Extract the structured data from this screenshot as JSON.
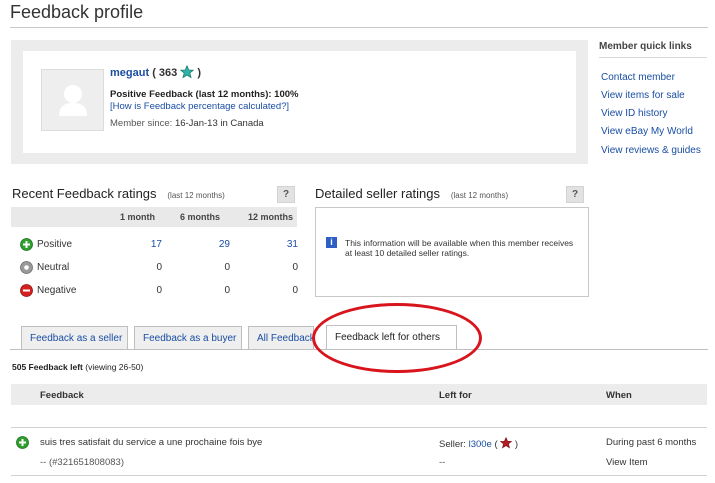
{
  "page": {
    "title": "Feedback profile"
  },
  "profile": {
    "username": "megaut",
    "score": "363",
    "positive_feedback": "Positive Feedback (last 12 months): 100%",
    "how_calc_link": "[How is Feedback percentage calculated?]",
    "member_since_label": "Member since:",
    "member_since_value": "16-Jan-13 in Canada"
  },
  "quick_links": {
    "title": "Member quick links",
    "items": [
      "Contact member",
      "View items for sale",
      "View ID history",
      "View eBay My World",
      "View reviews & guides"
    ]
  },
  "recent_ratings": {
    "title": "Recent Feedback ratings",
    "subtitle": "(last 12 months)",
    "help": "?",
    "columns": [
      "1 month",
      "6 months",
      "12 months"
    ],
    "rows": [
      {
        "label": "Positive",
        "values": [
          "17",
          "29",
          "31"
        ]
      },
      {
        "label": "Neutral",
        "values": [
          "0",
          "0",
          "0"
        ]
      },
      {
        "label": "Negative",
        "values": [
          "0",
          "0",
          "0"
        ]
      }
    ]
  },
  "dsr": {
    "title": "Detailed seller ratings",
    "subtitle": "(last 12 months)",
    "help": "?",
    "info": "i",
    "message": "This information will be available when this member receives at least 10 detailed seller ratings."
  },
  "tabs": [
    "Feedback as a seller",
    "Feedback as a buyer",
    "All Feedback",
    "Feedback left for others"
  ],
  "feedback_list": {
    "count": "505 Feedback left",
    "viewing": "(viewing 26-50)",
    "columns": {
      "feedback": "Feedback",
      "left_for": "Left for",
      "when": "When"
    },
    "row": {
      "comment": "suis tres satisfait du service a une prochaine fois bye",
      "item_ref": "-- (#321651808083)",
      "left_for_prefix": "Seller:",
      "seller_name": "l300e",
      "seller_open": "(",
      "seller_close": ")",
      "price": "--",
      "when": "During past 6 months",
      "view_item": "View Item"
    }
  },
  "colors": {
    "link": "#1a4ea3",
    "annotation": "#d8141c",
    "positive": "#2e9e2e",
    "negative": "#d42020"
  }
}
